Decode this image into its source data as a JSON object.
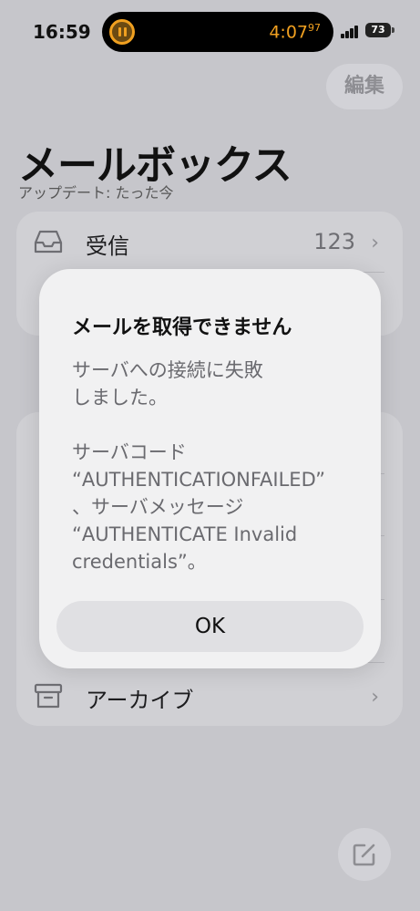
{
  "status_bar": {
    "time": "16:59",
    "timer": "4:07",
    "timer_fraction": "97",
    "battery_level": "73"
  },
  "header": {
    "edit_label": "編集",
    "title": "メールボックス",
    "subtitle": "アップデート: たった今"
  },
  "mailboxes": [
    {
      "label": "受信",
      "count": "123",
      "icon": "tray-icon"
    },
    {
      "label": "アーカイブ",
      "icon": "archive-box-icon"
    }
  ],
  "alert": {
    "title": "メールを取得できません",
    "message": "サーバへの接続に失敗\nしました。\n\nサーバコード\n“AUTHENTICATIONFAILED”\n、サーバメッセージ\n“AUTHENTICATE Invalid\ncredentials”。",
    "ok_label": "OK"
  },
  "colors": {
    "background": "#c6c6cb",
    "alert_background": "#f1f1f2",
    "timer_accent": "#f0a020"
  }
}
